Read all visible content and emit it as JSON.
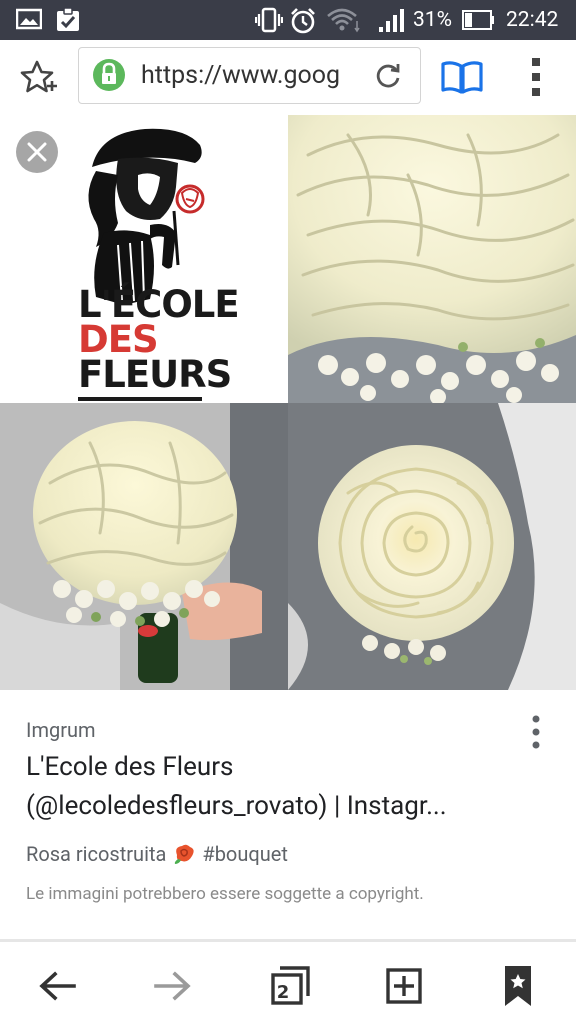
{
  "status_bar": {
    "battery_percent": "31%",
    "time": "22:42",
    "icons": [
      "gallery-icon",
      "task-done-icon",
      "vibrate-icon",
      "alarm-icon",
      "wifi-icon",
      "signal-icon",
      "battery-icon"
    ],
    "battery_level": 0.31
  },
  "browser": {
    "url": "https://www.goog",
    "icons": [
      "bookmark-star-icon",
      "lock-icon",
      "reload-icon",
      "reader-mode-icon",
      "overflow-menu-icon"
    ],
    "accent_color": "#1a73e8",
    "secure_color": "#5cb85c"
  },
  "collage": {
    "tiles": [
      "logo",
      "rose-top",
      "bouquet-left",
      "rose-closeup"
    ],
    "logo": {
      "line1": "L'ÉCOLE",
      "line2": "DES",
      "line3": "FLEURS"
    }
  },
  "result": {
    "source": "Imgrum",
    "title_line1": "L'Ecole des Fleurs",
    "title_line2": "(@lecoledesfleurs_rovato) | Instagr...",
    "description_text": "Rosa ricostruita",
    "description_tag": "#bouquet",
    "copyright_notice": "Le immagini potrebbero essere soggette a copyright."
  },
  "toolbar": {
    "tab_count": "2",
    "icons": [
      "back-arrow-icon",
      "forward-arrow-icon",
      "tab-switcher-icon",
      "new-tab-icon",
      "bookmark-icon"
    ]
  }
}
